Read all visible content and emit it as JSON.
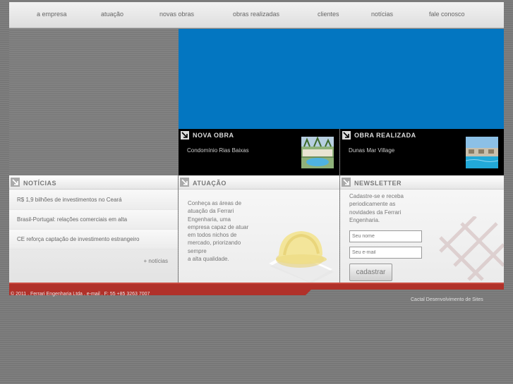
{
  "nav": {
    "items": [
      "a empresa",
      "atuação",
      "novas obras",
      "obras realizadas",
      "clientes",
      "notícias",
      "fale conosco"
    ]
  },
  "panels": {
    "nova_obra": {
      "title": "NOVA OBRA",
      "text": "Condomínio Rias Baixas"
    },
    "obra_realizada": {
      "title": "OBRA REALIZADA",
      "text": "Dunas Mar Village"
    }
  },
  "noticias": {
    "title": "NOTÍCIAS",
    "items": [
      "R$ 1,9 bilhões de investimentos no Ceará",
      "Brasil-Portugal: relações comerciais em alta",
      "CE reforça captação de investimento estrangeiro"
    ],
    "more": "+ notícias"
  },
  "atuacao": {
    "title": "ATUAÇÃO",
    "lines": [
      "Conheça as áreas de",
      "atuação da Ferrari",
      "Engenharia, uma",
      "empresa capaz de atuar",
      "em todos nichos de",
      "mercado, priorizando",
      "sempre",
      "a alta qualidade."
    ]
  },
  "newsletter": {
    "title": "NEWSLETTER",
    "lines": [
      "Cadastre-se e receba",
      "periodicamente as",
      "novidades da Ferrari",
      "Engenharia."
    ],
    "name_value": "Seu nome",
    "email_value": "Seu e-mail",
    "button": "cadastrar"
  },
  "footer": {
    "copyright": "© 2011 . Ferrari Engenharia Ltda . e-mail . F: 55 +85 3263 7007",
    "credit": "Cactal Desenvolvimento de Sites"
  },
  "colors": {
    "hero_blue": "#0376c1",
    "footer_red": "#b0312a",
    "panel_black": "#000000"
  }
}
